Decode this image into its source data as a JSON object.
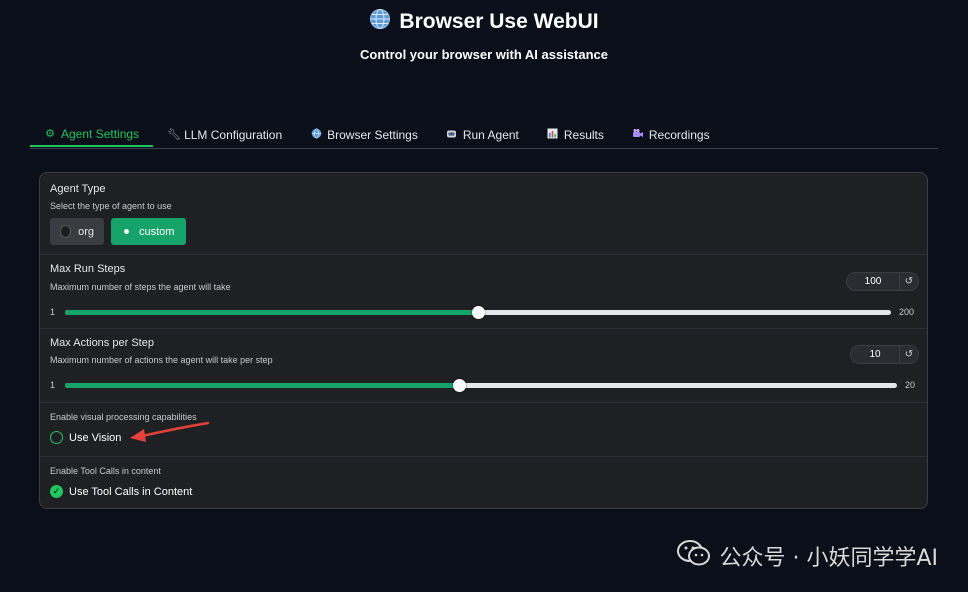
{
  "header": {
    "title": "Browser Use WebUI",
    "subtitle": "Control your browser with AI assistance"
  },
  "tabs": [
    {
      "label": "Agent Settings",
      "icon": "gear-icon",
      "active": true
    },
    {
      "label": "LLM Configuration",
      "icon": "wrench-icon"
    },
    {
      "label": "Browser Settings",
      "icon": "globe-icon"
    },
    {
      "label": "Run Agent",
      "icon": "robot-icon"
    },
    {
      "label": "Results",
      "icon": "chart-icon"
    },
    {
      "label": "Recordings",
      "icon": "camera-icon"
    }
  ],
  "agent_type": {
    "label": "Agent Type",
    "info": "Select the type of agent to use",
    "options": [
      "org",
      "custom"
    ],
    "selected": "custom"
  },
  "max_steps": {
    "label": "Max Run Steps",
    "info": "Maximum number of steps the agent will take",
    "value": "100",
    "min": "1",
    "max": "200",
    "reset": "↺"
  },
  "max_actions": {
    "label": "Max Actions per Step",
    "info": "Maximum number of actions the agent will take per step",
    "value": "10",
    "min": "1",
    "max": "20",
    "reset": "↺"
  },
  "use_vision": {
    "info": "Enable visual processing capabilities",
    "label": "Use Vision",
    "checked": false
  },
  "tool_calls": {
    "info": "Enable Tool Calls in content",
    "label": "Use Tool Calls in Content",
    "checked": true
  },
  "watermark": {
    "text": "公众号 · 小妖同学学AI"
  },
  "colors": {
    "accent": "#16a36a",
    "background": "#0b0f19",
    "panel": "#1f2023",
    "annotation_arrow": "#e5403a"
  }
}
